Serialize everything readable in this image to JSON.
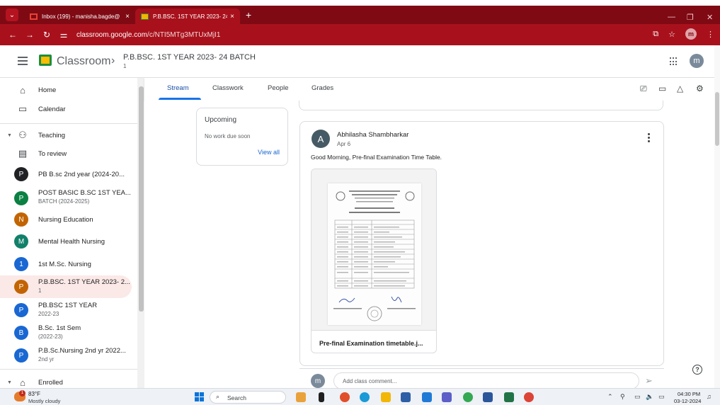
{
  "browser": {
    "tabs": [
      {
        "title": "Inbox (199) - manisha.bagde@",
        "close": "×"
      },
      {
        "title": "P.B.BSC. 1ST YEAR 2023- 24 BA",
        "close": "×"
      }
    ],
    "new_tab": "+",
    "url_prefix": "classroom.google.com",
    "url_path": "/c/NTI5MTg3MTUxMjI1",
    "profile_initial": "m"
  },
  "header": {
    "app_name": "Classroom",
    "course_title": "P.B.BSC. 1ST YEAR 2023- 24 BATCH",
    "course_section": "1",
    "user_initial": "m"
  },
  "sidebar": {
    "home": "Home",
    "calendar": "Calendar",
    "teaching": "Teaching",
    "to_review": "To review",
    "courses": [
      {
        "initial": "P",
        "name": "PB B.sc 2nd year (2024-20...",
        "sub": "",
        "color": "#202124"
      },
      {
        "initial": "P",
        "name": "POST BASIC B.SC 1ST YEA...",
        "sub": "BATCH (2024-2025)",
        "color": "#0b8043"
      },
      {
        "initial": "N",
        "name": "Nursing Education",
        "sub": "",
        "color": "#c26401"
      },
      {
        "initial": "M",
        "name": "Mental Health Nursing",
        "sub": "",
        "color": "#12806b"
      },
      {
        "initial": "1",
        "name": "1st M.Sc. Nursing",
        "sub": "",
        "color": "#1967d2"
      },
      {
        "initial": "P",
        "name": "P.B.BSC. 1ST YEAR 2023- 2...",
        "sub": "1",
        "color": "#c26401"
      },
      {
        "initial": "P",
        "name": "PB.BSC 1ST YEAR",
        "sub": "2022-23",
        "color": "#1967d2"
      },
      {
        "initial": "B",
        "name": "B.Sc. 1st Sem",
        "sub": "(2022-23)",
        "color": "#1967d2"
      },
      {
        "initial": "P",
        "name": "P.B.Sc.Nursing 2nd yr 2022...",
        "sub": "2nd yr",
        "color": "#1967d2"
      }
    ],
    "enrolled": "Enrolled"
  },
  "stream_tabs": [
    "Stream",
    "Classwork",
    "People",
    "Grades"
  ],
  "upcoming": {
    "heading": "Upcoming",
    "body": "No work due soon",
    "link": "View all"
  },
  "post": {
    "avatar_initial": "A",
    "author": "Abhilasha Shambharkar",
    "date": "Apr 6",
    "message": "Good Morning, Pre-final Examination Time Table.",
    "attachment_name": "Pre-final Examination timetable.j..."
  },
  "comment": {
    "avatar_initial": "m",
    "placeholder": "Add class comment..."
  },
  "taskbar": {
    "temperature": "83°F",
    "condition": "Mostly cloudy",
    "search": "Search",
    "time": "04:30 PM",
    "date": "03-12-2024"
  },
  "colors": {
    "browser_frame": "#7f0a14",
    "accent_blue": "#1a73e8"
  }
}
